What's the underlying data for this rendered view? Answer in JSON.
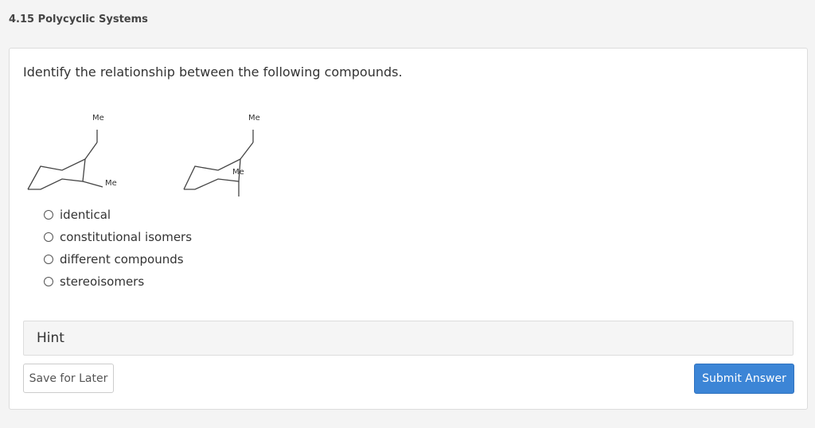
{
  "section": {
    "title": "4.15 Polycyclic Systems"
  },
  "question": {
    "prompt": "Identify the relationship between the following compounds.",
    "substituent_label": "Me"
  },
  "options": [
    {
      "label": "identical"
    },
    {
      "label": "constitutional isomers"
    },
    {
      "label": "different compounds"
    },
    {
      "label": "stereoisomers"
    }
  ],
  "hint": {
    "label": "Hint"
  },
  "buttons": {
    "save_label": "Save for Later",
    "submit_label": "Submit Answer"
  },
  "colors": {
    "accent": "#3c85d6",
    "card_border": "#dcdcdc",
    "hint_bg": "#f5f5f5"
  }
}
